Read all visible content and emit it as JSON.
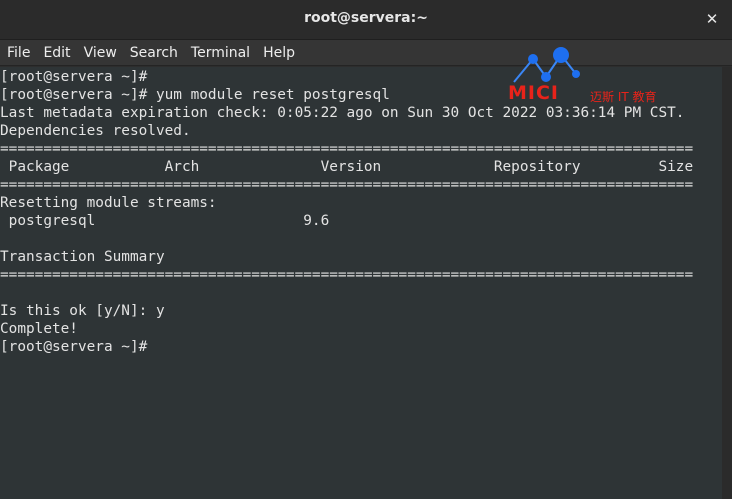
{
  "window": {
    "title": "root@servera:~",
    "close_glyph": "✕"
  },
  "menu": {
    "items": [
      "File",
      "Edit",
      "View",
      "Search",
      "Terminal",
      "Help"
    ]
  },
  "terminal": {
    "lines": [
      "[root@servera ~]#",
      "[root@servera ~]# yum module reset postgresql",
      "Last metadata expiration check: 0:05:22 ago on Sun 30 Oct 2022 03:36:14 PM CST.",
      "Dependencies resolved.",
      "================================================================================",
      " Package           Arch              Version             Repository         Size",
      "================================================================================",
      "Resetting module streams:",
      " postgresql                        9.6",
      "",
      "Transaction Summary",
      "================================================================================",
      "",
      "Is this ok [y/N]: y",
      "Complete!",
      "[root@servera ~]#"
    ]
  },
  "watermark": {
    "brand": "MICI",
    "subtitle": "迈斯 IT 教育",
    "color": "#e8231a",
    "dot_color": "#1e6ff0"
  }
}
